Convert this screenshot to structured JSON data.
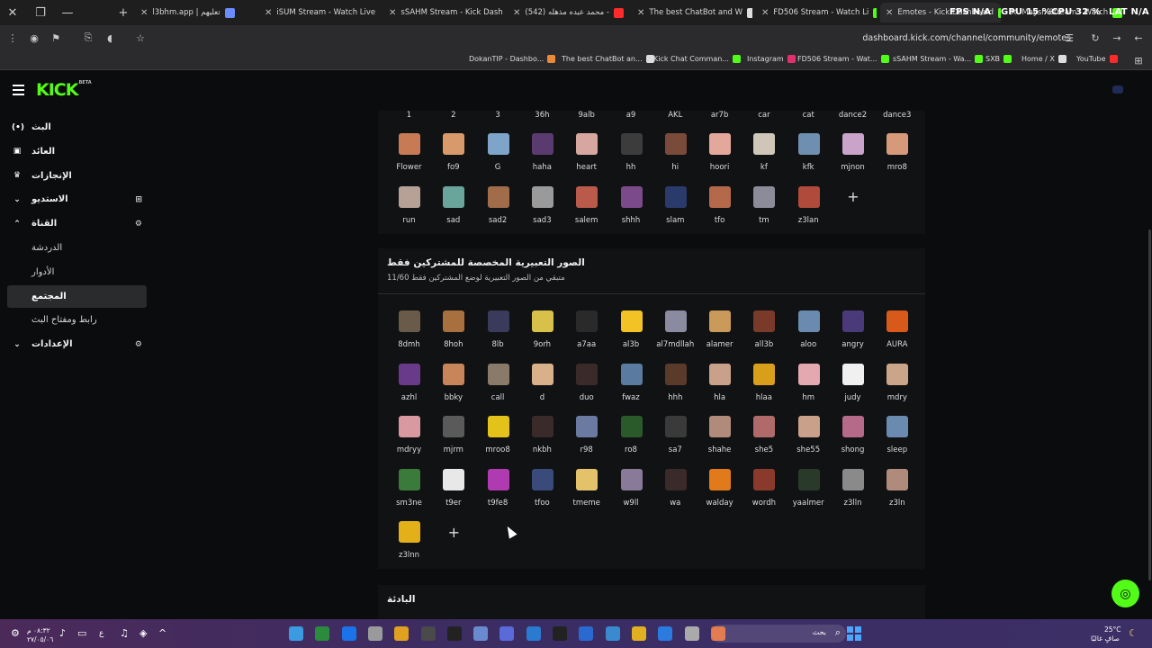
{
  "browser": {
    "tabs": [
      {
        "title": "l3bhm.app | تعليهم",
        "active": false,
        "color": "#6a8cff"
      },
      {
        "title": "iSUM Stream - Watch Live",
        "active": false,
        "color": "#53fc18"
      },
      {
        "title": "sSAHM Stream - Kick Dash",
        "active": false,
        "color": "#53fc18"
      },
      {
        "title": "(542) محمد عبده مذهله -",
        "active": false,
        "color": "#ff2a2a"
      },
      {
        "title": "The best ChatBot and W",
        "active": false,
        "color": "#dddddd"
      },
      {
        "title": "FD506 Stream - Watch Li",
        "active": false,
        "color": "#53fc18"
      },
      {
        "title": "Emotes - Kick Dashboard",
        "active": true,
        "color": "#53fc18"
      },
      {
        "title": "Maysh Stream - Watch",
        "active": false,
        "color": "#53fc18"
      }
    ],
    "overlay": {
      "fps": "FPS N/A",
      "gpu": "GPU 15 %",
      "cpu": "CPU 32 %",
      "lat": "LAT N/A"
    },
    "url": "dashboard.kick.com/channel/community/emotes",
    "bookmarks": [
      {
        "label": "DokanTIP - Dashbo...",
        "color": "#e98a3b"
      },
      {
        "label": "The best ChatBot an...",
        "color": "#dddddd"
      },
      {
        "label": "Kick Chat Comman...",
        "color": "#53fc18"
      },
      {
        "label": "Instagram",
        "color": "#e1306c"
      },
      {
        "label": "FD506 Stream - Wat...",
        "color": "#53fc18"
      },
      {
        "label": "sSAHM Stream - Wa...",
        "color": "#53fc18"
      },
      {
        "label": "SXB",
        "color": "#53fc18"
      },
      {
        "label": "Home / X",
        "color": "#dddddd"
      },
      {
        "label": "YouTube",
        "color": "#ff2a2a"
      }
    ]
  },
  "kick": {
    "logo": "KICK",
    "logo_sup": "BETA",
    "sidebar": [
      {
        "label": "البث",
        "icon": "(•)",
        "sub": false,
        "active": false,
        "chevron": "",
        "right": ""
      },
      {
        "label": "العائد",
        "icon": "▣",
        "sub": false,
        "active": false,
        "chevron": "",
        "right": ""
      },
      {
        "label": "الإنجازات",
        "icon": "♛",
        "sub": false,
        "active": false,
        "chevron": "",
        "right": ""
      },
      {
        "label": "الاستديو",
        "icon": "",
        "sub": false,
        "active": false,
        "chevron": "⌄",
        "right": "⊞"
      },
      {
        "label": "القناة",
        "icon": "",
        "sub": false,
        "active": false,
        "chevron": "⌃",
        "right": "⚙"
      },
      {
        "label": "الدردشة",
        "icon": "",
        "sub": true,
        "active": false,
        "chevron": "",
        "right": ""
      },
      {
        "label": "الأدوار",
        "icon": "",
        "sub": true,
        "active": false,
        "chevron": "",
        "right": ""
      },
      {
        "label": "المجتمع",
        "icon": "",
        "sub": true,
        "active": true,
        "chevron": "",
        "right": ""
      },
      {
        "label": "رابط ومفتاح البث",
        "icon": "",
        "sub": true,
        "active": false,
        "chevron": "",
        "right": ""
      },
      {
        "label": "الإعدادات",
        "icon": "",
        "sub": false,
        "active": false,
        "chevron": "⌄",
        "right": "⚙"
      }
    ],
    "global_top_labels": [
      "1",
      "2",
      "3",
      "36h",
      "9alb",
      "a9",
      "AKL",
      "ar7b",
      "car",
      "cat",
      "dance2",
      "dance3"
    ],
    "global_emotes": [
      {
        "name": "Flower",
        "color": "#c77b55"
      },
      {
        "name": "fo9",
        "color": "#d89a6a"
      },
      {
        "name": "G",
        "color": "#7fa4c9"
      },
      {
        "name": "haha",
        "color": "#5a3b6f"
      },
      {
        "name": "heart",
        "color": "#d8a6a0"
      },
      {
        "name": "hh",
        "color": "#3c3c3c"
      },
      {
        "name": "hi",
        "color": "#7a4a3a"
      },
      {
        "name": "hoori",
        "color": "#e3a79c"
      },
      {
        "name": "kf",
        "color": "#cfc6b8"
      },
      {
        "name": "kfk",
        "color": "#6f8fb0"
      },
      {
        "name": "mjnon",
        "color": "#c9a3c9"
      },
      {
        "name": "mro8",
        "color": "#d69a7a"
      },
      {
        "name": "run",
        "color": "#b7a196"
      },
      {
        "name": "sad",
        "color": "#6aa59b"
      },
      {
        "name": "sad2",
        "color": "#a06c4a"
      },
      {
        "name": "sad3",
        "color": "#9a9a9a"
      },
      {
        "name": "salem",
        "color": "#b95a4a"
      },
      {
        "name": "shhh",
        "color": "#7a4a8a"
      },
      {
        "name": "slam",
        "color": "#2a3a6a"
      },
      {
        "name": "tfo",
        "color": "#b46a4a"
      },
      {
        "name": "tm",
        "color": "#8b8b9a"
      },
      {
        "name": "z3lan",
        "color": "#b04a3a"
      }
    ],
    "sub_section": {
      "title": "الصور التعبيرية المخصصة للمشتركين فقط",
      "subtitle": "متبقي من الصور التعبيرية لوضع المشتركين فقط 11/60"
    },
    "sub_emotes": [
      {
        "name": "8dmh",
        "color": "#6a5a4a"
      },
      {
        "name": "8hoh",
        "color": "#a8703f"
      },
      {
        "name": "8lb",
        "color": "#3a3a5a"
      },
      {
        "name": "9orh",
        "color": "#d8c14a"
      },
      {
        "name": "a7aa",
        "color": "#2a2a2a"
      },
      {
        "name": "al3b",
        "color": "#f3c326"
      },
      {
        "name": "al7mdllah",
        "color": "#8a8aa0"
      },
      {
        "name": "alamer",
        "color": "#c99a5a"
      },
      {
        "name": "all3b",
        "color": "#7a3a2a"
      },
      {
        "name": "aloo",
        "color": "#6a8ab0"
      },
      {
        "name": "angry",
        "color": "#4a3a7a"
      },
      {
        "name": "AURA",
        "color": "#d85a1a"
      },
      {
        "name": "azhl",
        "color": "#6a3a8a"
      },
      {
        "name": "bbky",
        "color": "#c9855a"
      },
      {
        "name": "call",
        "color": "#8a7a6a"
      },
      {
        "name": "d",
        "color": "#d8b08a"
      },
      {
        "name": "duo",
        "color": "#3a2a2a"
      },
      {
        "name": "fwaz",
        "color": "#5a7aa0"
      },
      {
        "name": "hhh",
        "color": "#5a3a2a"
      },
      {
        "name": "hla",
        "color": "#c9a08a"
      },
      {
        "name": "hlaa",
        "color": "#d8a01a"
      },
      {
        "name": "hm",
        "color": "#e3a8b0"
      },
      {
        "name": "judy",
        "color": "#f0f0f0"
      },
      {
        "name": "mdry",
        "color": "#caa58a"
      },
      {
        "name": "mdryy",
        "color": "#d89aa0"
      },
      {
        "name": "mjrm",
        "color": "#5a5a5a"
      },
      {
        "name": "mroo8",
        "color": "#e3c21a"
      },
      {
        "name": "nkbh",
        "color": "#3a2a2a"
      },
      {
        "name": "r98",
        "color": "#6a7aa0"
      },
      {
        "name": "ro8",
        "color": "#2a5a2a"
      },
      {
        "name": "sa7",
        "color": "#3a3a3a"
      },
      {
        "name": "shahe",
        "color": "#b08a7a"
      },
      {
        "name": "she5",
        "color": "#b06a6a"
      },
      {
        "name": "she55",
        "color": "#c9a08a"
      },
      {
        "name": "shong",
        "color": "#b56a8a"
      },
      {
        "name": "sleep",
        "color": "#6a8ab0"
      },
      {
        "name": "sm3ne",
        "color": "#3a7a3a"
      },
      {
        "name": "t9er",
        "color": "#e8e8e8"
      },
      {
        "name": "t9fe8",
        "color": "#b03ab0"
      },
      {
        "name": "tfoo",
        "color": "#3a4a7a"
      },
      {
        "name": "tmeme",
        "color": "#e3c26a"
      },
      {
        "name": "w9ll",
        "color": "#8a7a9a"
      },
      {
        "name": "wa",
        "color": "#3a2a2a"
      },
      {
        "name": "walday",
        "color": "#e07a1a"
      },
      {
        "name": "wordh",
        "color": "#8a3a2a"
      },
      {
        "name": "yaalmer",
        "color": "#2a3a2a"
      },
      {
        "name": "z3lln",
        "color": "#8a8a8a"
      },
      {
        "name": "z3ln",
        "color": "#b08a7a"
      },
      {
        "name": "z3lnn",
        "color": "#e3b01a"
      }
    ],
    "rooms_title": "البادئة"
  },
  "taskbar": {
    "time": "٠٨:٣٢ م",
    "date": "٢٧/٠٥/٠٦",
    "lang": "ع",
    "search": "بحث",
    "weather_temp": "25°C",
    "weather_desc": "صافٍ غالبًا",
    "app_colors": [
      "#3b9ae0",
      "#2b8a3e",
      "#1a73e8",
      "#9a9a9a",
      "#e0a020",
      "#4a4a4a",
      "#222222",
      "#6a8ad0",
      "#5a6ad8",
      "#2a7ad0",
      "#222222",
      "#2a6ad0",
      "#3a8ad0",
      "#e0b020",
      "#2a7ae0",
      "#aaaaaa",
      "#e06a3a"
    ]
  }
}
